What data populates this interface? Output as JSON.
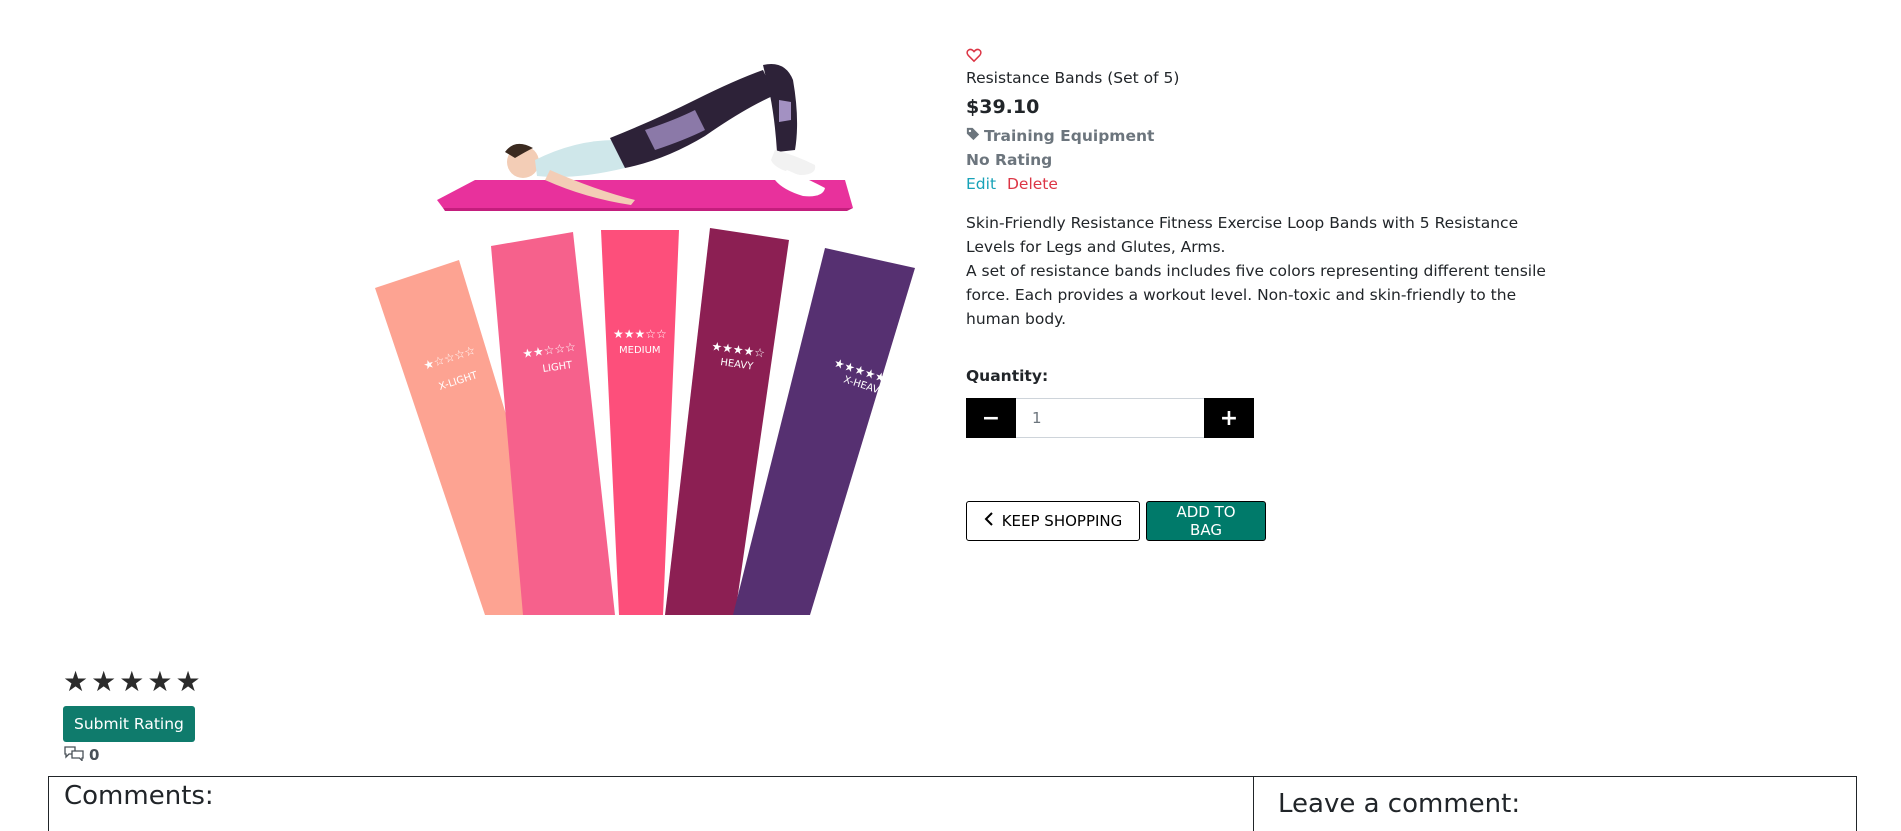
{
  "product": {
    "name": "Resistance Bands (Set of 5)",
    "price": "$39.10",
    "category": "Training Equipment",
    "rating_text": "No Rating",
    "description_line1": "Skin-Friendly Resistance Fitness Exercise Loop Bands with 5 Resistance Levels for Legs and Glutes, Arms.",
    "description_line2": "A set of resistance bands includes five colors representing different tensile force. Each provides a workout level. Non-toxic and skin-friendly to the human body.",
    "band_labels": [
      "X-LIGHT",
      "LIGHT",
      "MEDIUM",
      "HEAVY",
      "X-HEAVY"
    ],
    "band_colors": [
      "#fda392",
      "#f6618c",
      "#fd4f7b",
      "#8c1f53",
      "#563071"
    ]
  },
  "admin": {
    "edit_label": "Edit",
    "delete_label": "Delete"
  },
  "quantity": {
    "label": "Quantity:",
    "value": "1",
    "minus_symbol": "−",
    "plus_symbol": "+"
  },
  "actions": {
    "keep_shopping_label": "KEEP SHOPPING",
    "add_to_bag_label": "ADD TO BAG"
  },
  "rating_form": {
    "stars": [
      "★",
      "★",
      "★",
      "★",
      "★"
    ],
    "submit_label": "Submit Rating",
    "comment_count": "0"
  },
  "comments": {
    "title": "Comments:",
    "leave_title": "Leave a comment:"
  },
  "colors": {
    "accent": "#007a6a",
    "heart": "#dc3545",
    "edit": "#17a2b8",
    "delete": "#dc3545"
  },
  "icons": {
    "heart": "heart-outline-icon",
    "tag": "tag-icon",
    "back": "chevron-left-icon",
    "comments": "comments-icon"
  }
}
